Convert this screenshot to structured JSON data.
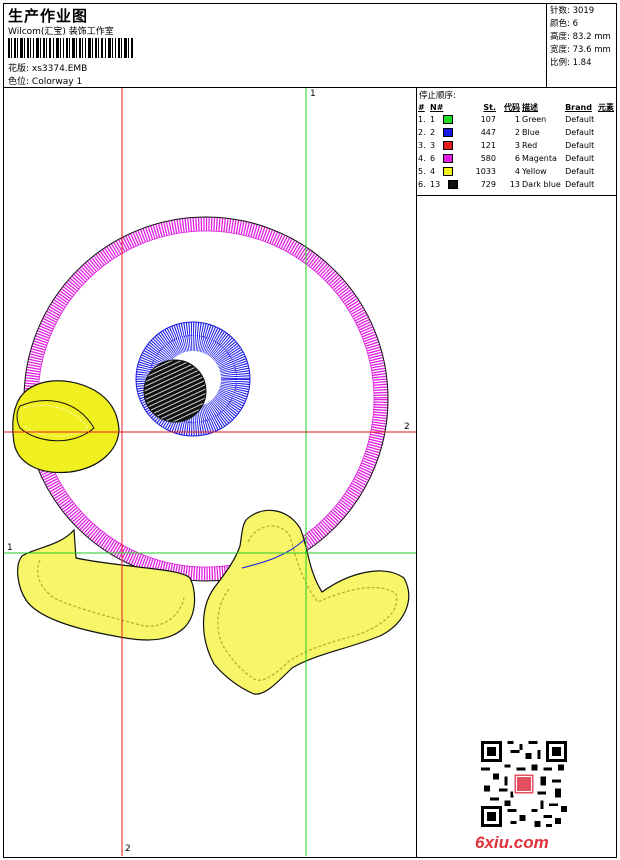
{
  "header": {
    "title": "生产作业图",
    "studio": "Wilcom(汇宝) 装饰工作室",
    "design_label": "花版:",
    "design_value": "xs3374.EMB",
    "color_label": "色位:",
    "color_value": "Colorway 1"
  },
  "stats": {
    "stitches": "针数: 3019",
    "colors": "颜色: 6",
    "height": "高度: 83.2 mm",
    "width": "宽度: 73.6 mm",
    "scale": "比例: 1.84"
  },
  "stop_sequence": {
    "title": "停止顺序:",
    "headers": [
      "#",
      "N#",
      "St.",
      "代码",
      "描述",
      "Brand",
      "元素"
    ],
    "rows": [
      {
        "idx": "1.",
        "n": "1",
        "color": "#22dd22",
        "st": "107",
        "code": "1",
        "desc": "Green",
        "brand": "Default"
      },
      {
        "idx": "2.",
        "n": "2",
        "color": "#1a1ae6",
        "st": "447",
        "code": "2",
        "desc": "Blue",
        "brand": "Default"
      },
      {
        "idx": "3.",
        "n": "3",
        "color": "#e61a1a",
        "st": "121",
        "code": "3",
        "desc": "Red",
        "brand": "Default"
      },
      {
        "idx": "4.",
        "n": "6",
        "color": "#e61ae6",
        "st": "580",
        "code": "6",
        "desc": "Magenta",
        "brand": "Default"
      },
      {
        "idx": "5.",
        "n": "4",
        "color": "#f2f21a",
        "st": "1033",
        "code": "4",
        "desc": "Yellow",
        "brand": "Default"
      },
      {
        "idx": "6.",
        "n": "13",
        "color": "#111111",
        "st": "729",
        "code": "13",
        "desc": "Dark blue",
        "brand": "Default"
      }
    ]
  },
  "canvas": {
    "guide_labels": {
      "green_v": "1",
      "red_h": "2",
      "green_h": "1",
      "red_v": "2"
    },
    "colors": {
      "magenta": "#e020e0",
      "blue": "#1a1ae6",
      "yellow": "#f0f020",
      "outline": "#000000",
      "red_guide": "#e61a1a",
      "green_guide": "#22cc22"
    }
  },
  "watermark": {
    "site": "6xiu.com"
  }
}
